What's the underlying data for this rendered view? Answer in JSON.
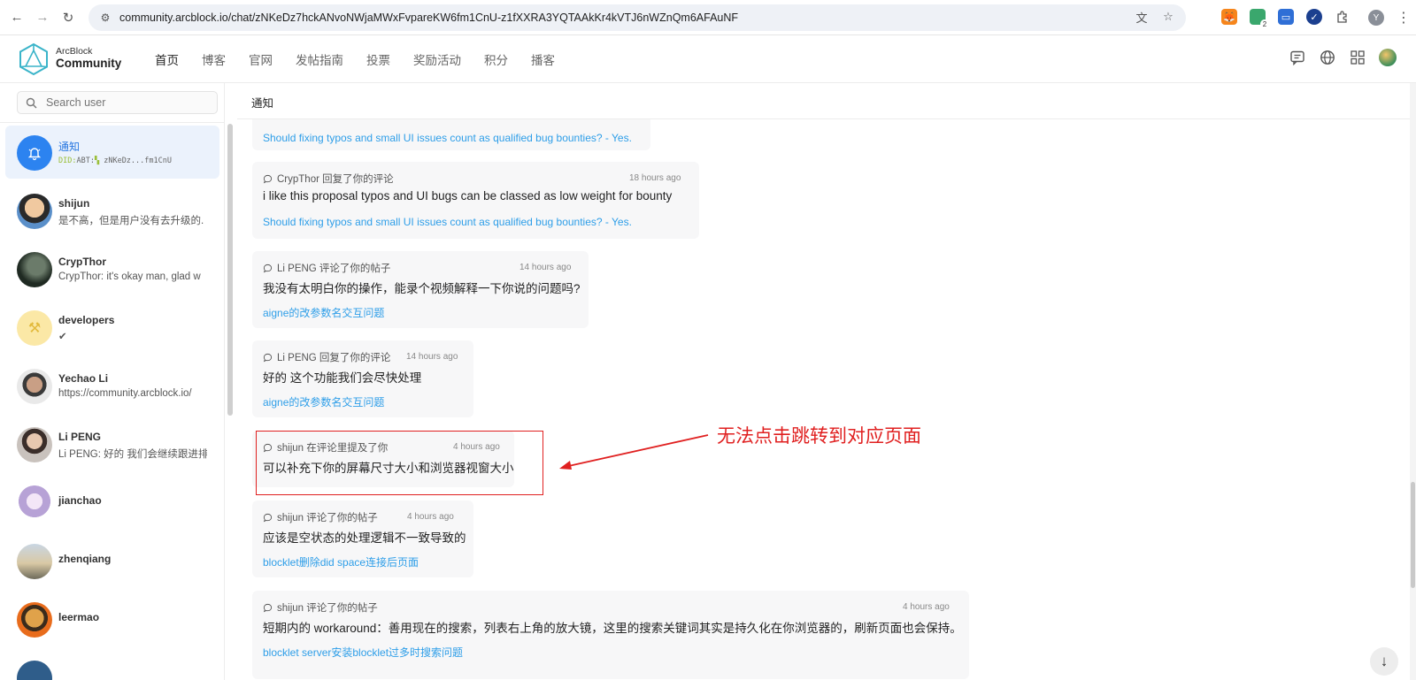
{
  "browser": {
    "url": "community.arcblock.io/chat/zNKeDz7hckANvoNWjaMWxFvpareKW6fm1CnU-z1fXXRA3YQTAAkKr4kVTJ6nWZnQm6AFAuNF",
    "profile_letter": "Y",
    "back_icon": "←",
    "forward_icon": "→",
    "reload_icon": "↻",
    "tune_icon": "⚙",
    "translate_icon": "文",
    "star_icon": "☆",
    "menu_icon": "⋮",
    "ext_badge": "2"
  },
  "header": {
    "brand_top": "ArcBlock",
    "brand_bottom": "Community",
    "nav": [
      "首页",
      "博客",
      "官网",
      "发帖指南",
      "投票",
      "奖励活动",
      "积分",
      "播客"
    ]
  },
  "sidebar": {
    "search_placeholder": "Search user",
    "contacts": [
      {
        "name": "通知",
        "did_prefix": "DID:",
        "did_rest": "ABT:",
        "did_short": "zNKeDz...fm1CnU",
        "selected": true
      },
      {
        "name": "shijun",
        "message": "是不高，但是用户没有去升级的."
      },
      {
        "name": "CrypThor",
        "message": "CrypThor: it's okay man, glad w"
      },
      {
        "name": "developers",
        "message": "✔"
      },
      {
        "name": "Yechao Li",
        "message": "https://community.arcblock.io/"
      },
      {
        "name": "Li PENG",
        "message": "Li PENG: 好的 我们会继续跟进排"
      },
      {
        "name": "jianchao",
        "message": ""
      },
      {
        "name": "zhenqiang",
        "message": ""
      },
      {
        "name": "leermao",
        "message": ""
      }
    ]
  },
  "main": {
    "title": "通知",
    "notifications": [
      {
        "meta": "",
        "time": "",
        "body": "",
        "link": "Should fixing typos and small UI issues count as qualified bug bounties? - Yes."
      },
      {
        "meta": "CrypThor 回复了你的评论",
        "time": "18 hours ago",
        "body": "i like this proposal typos and UI bugs can be classed as low weight for bounty",
        "link": "Should fixing typos and small UI issues count as qualified bug bounties? - Yes."
      },
      {
        "meta": "Li PENG 评论了你的帖子",
        "time": "14 hours ago",
        "body": "我没有太明白你的操作，能录个视频解释一下你说的问题吗?",
        "link": "aigne的改参数名交互问题"
      },
      {
        "meta": "Li PENG 回复了你的评论",
        "time": "14 hours ago",
        "body": "好的 这个功能我们会尽快处理",
        "link": "aigne的改参数名交互问题"
      },
      {
        "meta": "shijun 在评论里提及了你",
        "time": "4 hours ago",
        "body": "可以补充下你的屏幕尺寸大小和浏览器视窗大小",
        "link": ""
      },
      {
        "meta": "shijun 评论了你的帖子",
        "time": "4 hours ago",
        "body": "应该是空状态的处理逻辑不一致导致的",
        "link": "blocklet删除did space连接后页面"
      },
      {
        "meta": "shijun 评论了你的帖子",
        "time": "4 hours ago",
        "body": "短期内的 workaround：善用现在的搜索，列表右上角的放大镜，这里的搜索关键词其实是持久化在你浏览器的，刷新页面也会保持。",
        "link": "blocklet server安装blocklet过多时搜索问题"
      }
    ],
    "annotation": "无法点击跳转到对应页面",
    "scroll_down_icon": "↓"
  },
  "colors": {
    "accent": "#2877e0",
    "link": "#2e9ee8",
    "annotation": "#e02020",
    "selected_bg": "#ebf2fc"
  }
}
